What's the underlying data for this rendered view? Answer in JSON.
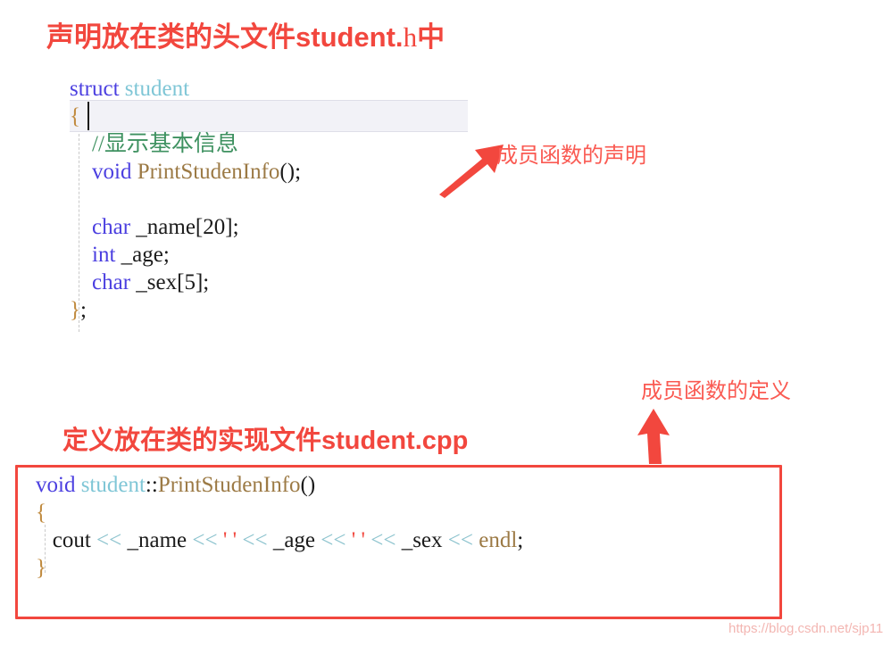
{
  "headings": {
    "declaration": {
      "main": "声明放在类的头文件student.",
      "ext": "h",
      "suffix": "中"
    },
    "definition": {
      "text": "定义放在类的实现文件student.cpp"
    }
  },
  "annotations": {
    "member_function_declaration": "成员函数的声明",
    "member_function_definition": "成员函数的定义",
    "arrow_declaration_icon": "arrow-up-right-icon",
    "arrow_definition_icon": "arrow-up-icon"
  },
  "header_code": {
    "filename_implied": "student.h",
    "lines": [
      {
        "tokens": [
          {
            "t": "struct",
            "c": "kw"
          },
          {
            "t": " ",
            "c": "plain"
          },
          {
            "t": "student",
            "c": "type"
          }
        ]
      },
      {
        "tokens": [
          {
            "t": "{",
            "c": "brace"
          }
        ],
        "highlighted": true
      },
      {
        "tokens": [
          {
            "t": "    ",
            "c": "plain"
          },
          {
            "t": "//显示基本信息",
            "c": "cmt"
          }
        ]
      },
      {
        "tokens": [
          {
            "t": "    ",
            "c": "plain"
          },
          {
            "t": "void",
            "c": "kw"
          },
          {
            "t": " ",
            "c": "plain"
          },
          {
            "t": "PrintStudenInfo",
            "c": "fn"
          },
          {
            "t": "();",
            "c": "punct"
          }
        ]
      },
      {
        "tokens": [
          {
            "t": " ",
            "c": "plain"
          }
        ]
      },
      {
        "tokens": [
          {
            "t": "    ",
            "c": "plain"
          },
          {
            "t": "char",
            "c": "kw"
          },
          {
            "t": " _name",
            "c": "plain"
          },
          {
            "t": "[",
            "c": "punct"
          },
          {
            "t": "20",
            "c": "num"
          },
          {
            "t": "];",
            "c": "punct"
          }
        ]
      },
      {
        "tokens": [
          {
            "t": "    ",
            "c": "plain"
          },
          {
            "t": "int",
            "c": "kw"
          },
          {
            "t": " _age",
            "c": "plain"
          },
          {
            "t": ";",
            "c": "punct"
          }
        ]
      },
      {
        "tokens": [
          {
            "t": "    ",
            "c": "plain"
          },
          {
            "t": "char",
            "c": "kw"
          },
          {
            "t": " _sex",
            "c": "plain"
          },
          {
            "t": "[",
            "c": "punct"
          },
          {
            "t": "5",
            "c": "num"
          },
          {
            "t": "];",
            "c": "punct"
          }
        ]
      },
      {
        "tokens": [
          {
            "t": "}",
            "c": "brace"
          },
          {
            "t": ";",
            "c": "punct"
          }
        ]
      }
    ],
    "plain_text": "struct student\n{\n    //显示基本信息\n    void PrintStudenInfo();\n\n    char _name[20];\n    int _age;\n    char _sex[5];\n};"
  },
  "impl_code": {
    "filename_implied": "student.cpp",
    "lines": [
      {
        "tokens": [
          {
            "t": "void",
            "c": "kw"
          },
          {
            "t": " ",
            "c": "plain"
          },
          {
            "t": "student",
            "c": "type"
          },
          {
            "t": "::",
            "c": "punct"
          },
          {
            "t": "PrintStudenInfo",
            "c": "fn"
          },
          {
            "t": "()",
            "c": "punct"
          }
        ]
      },
      {
        "tokens": [
          {
            "t": "{",
            "c": "brace"
          }
        ]
      },
      {
        "tokens": [
          {
            "t": "   ",
            "c": "plain"
          },
          {
            "t": "cout",
            "c": "plain"
          },
          {
            "t": " ",
            "c": "plain"
          },
          {
            "t": "<<",
            "c": "op"
          },
          {
            "t": " _name ",
            "c": "plain"
          },
          {
            "t": "<<",
            "c": "op"
          },
          {
            "t": " ",
            "c": "plain"
          },
          {
            "t": "' '",
            "c": "chr"
          },
          {
            "t": " ",
            "c": "plain"
          },
          {
            "t": "<<",
            "c": "op"
          },
          {
            "t": " _age ",
            "c": "plain"
          },
          {
            "t": "<<",
            "c": "op"
          },
          {
            "t": " ",
            "c": "plain"
          },
          {
            "t": "' '",
            "c": "chr"
          },
          {
            "t": " ",
            "c": "plain"
          },
          {
            "t": "<<",
            "c": "op"
          },
          {
            "t": " _sex ",
            "c": "plain"
          },
          {
            "t": "<<",
            "c": "op"
          },
          {
            "t": " ",
            "c": "plain"
          },
          {
            "t": "endl",
            "c": "fn"
          },
          {
            "t": ";",
            "c": "punct"
          }
        ]
      },
      {
        "tokens": [
          {
            "t": "}",
            "c": "brace"
          }
        ]
      }
    ],
    "plain_text": "void student::PrintStudenInfo()\n{\n   cout << _name << ' ' << _age << ' ' << _sex << endl;\n}"
  },
  "watermark": {
    "text": "https://blog.csdn.net/sjp11"
  },
  "colors": {
    "accent_red": "#F2473E",
    "annotation_red": "#FA5A52",
    "keyword_blue": "#4B3FE0",
    "type_cyan": "#7FC6D6",
    "function_tan": "#9C7A45",
    "comment_green": "#3E9160",
    "brace_orange": "#C08A3E",
    "operator_teal": "#8CC3CE",
    "char_literal_red": "#F2473E",
    "line_highlight": "#F2F2F7"
  }
}
